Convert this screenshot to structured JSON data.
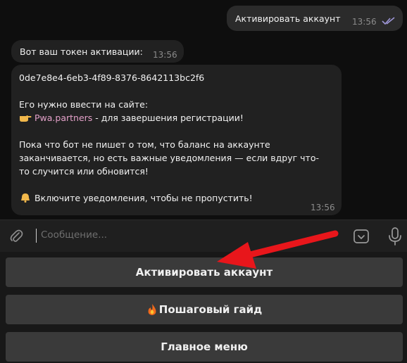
{
  "messages": {
    "outgoing": {
      "text": "Активировать аккаунт",
      "time": "13:56"
    },
    "incoming1": {
      "text": "Вот ваш токен активации:",
      "time": "13:56"
    },
    "incoming2": {
      "token": "0de7e8e4-6eb3-4f89-8376-8642113bc2f6",
      "line1": "Его нужно ввести на сайте:",
      "link": "Pwa.partners",
      "link_suffix": " - для завершения регистрации!",
      "para1": "Пока что бот не пишет о том, что баланс на аккаунте",
      "para2": "заканчивается, но есть важные уведомления — если вдруг что-",
      "para3": "то случится или обновится!",
      "notice": "Включите уведомления, чтобы не пропустить!",
      "time": "13:56"
    }
  },
  "composer": {
    "placeholder": "Сообщение..."
  },
  "keyboard": {
    "buttons": [
      {
        "label": "Активировать аккаунт"
      },
      {
        "label": "Пошаговый гайд"
      },
      {
        "label": "Главное меню"
      }
    ]
  },
  "icons": {
    "point": "finger-pointing-right-icon",
    "bell": "bell-icon",
    "fire": "fire-icon",
    "attach": "paperclip-icon",
    "commands": "keyboard-toggle-icon",
    "mic": "microphone-icon",
    "read": "double-check-icon"
  },
  "colors": {
    "link": "#e4a1c9",
    "arrow": "#e8161b",
    "read_ticks": "#9d96d6"
  }
}
